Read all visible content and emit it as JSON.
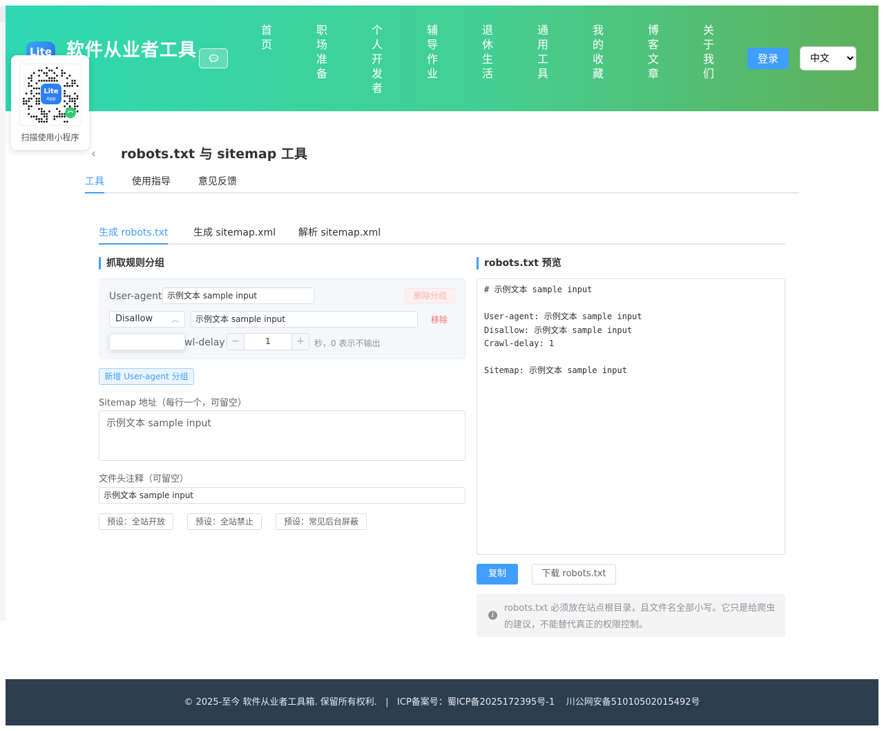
{
  "header": {
    "logo_text": "Lite",
    "site_title": "软件从业者工具",
    "nav": [
      "首页",
      "职场准备",
      "个人开发者",
      "辅导作业",
      "退休生活",
      "通用工具",
      "我的收藏",
      "博客文章",
      "关于我们"
    ],
    "login_label": "登录",
    "language_options": [
      "中文"
    ]
  },
  "qr": {
    "caption": "扫描使用小程序",
    "badge_line1": "Lite",
    "badge_line2": "App"
  },
  "page": {
    "title": "robots.txt 与 sitemap 工具",
    "tabs": [
      "工具",
      "使用指导",
      "意见反馈"
    ]
  },
  "subtabs": [
    "生成 robots.txt",
    "生成 sitemap.xml",
    "解析 sitemap.xml"
  ],
  "rules": {
    "heading": "抓取规则分组",
    "user_agent_label": "User-agent",
    "user_agent_value": "示例文本 sample input",
    "delete_group_label": "删除分组",
    "rule_type": "Disallow",
    "rule_value": "示例文本 sample input",
    "remove_label": "移除",
    "crawl_delay_label": "wl-delay",
    "crawl_delay_value": "1",
    "stepper_minus": "−",
    "stepper_plus": "+",
    "crawl_delay_hint": "秒，0 表示不输出",
    "add_group_label": "新增 User-agent 分组",
    "sitemap_label": "Sitemap 地址（每行一个，可留空）",
    "sitemap_value": "示例文本 sample input",
    "header_comment_label": "文件头注释（可留空）",
    "header_comment_value": "示例文本 sample input",
    "presets": [
      "预设：全站开放",
      "预设：全站禁止",
      "预设：常见后台屏蔽"
    ]
  },
  "preview": {
    "heading": "robots.txt 预览",
    "lines": [
      "# 示例文本 sample input",
      "",
      "User-agent: 示例文本 sample input",
      "Disallow: 示例文本 sample input",
      "Crawl-delay: 1",
      "",
      "Sitemap: 示例文本 sample input"
    ],
    "copy_label": "复制",
    "download_label": "下载 robots.txt",
    "info_icon": "i",
    "info_text": "robots.txt 必须放在站点根目录，且文件名全部小写。它只是给爬虫的建议，不能替代真正的权限控制。"
  },
  "footer": {
    "text": "© 2025-至今 软件从业者工具箱. 保留所有权利.   |   ICP备案号：蜀ICP备2025172395号-1    川公网安备51010502015492号"
  },
  "colors": {
    "accent": "#409eff",
    "header_gradient_start": "#2ed8b2",
    "header_gradient_end": "#5fb05a",
    "danger": "#f56c6c",
    "footer_bg": "#2c3e50"
  }
}
